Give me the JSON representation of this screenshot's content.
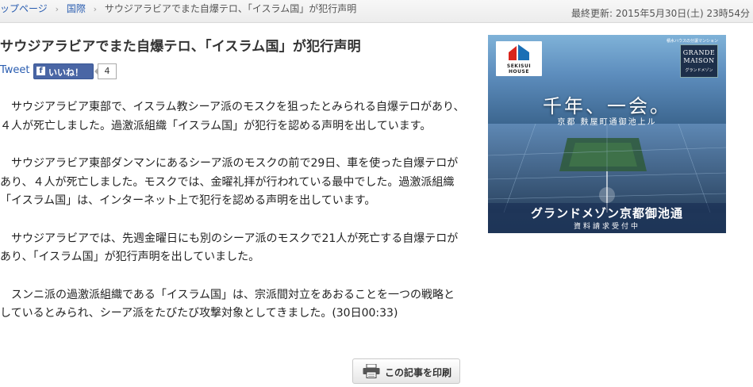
{
  "breadcrumb": {
    "items": [
      "ップページ",
      "国際",
      "サウジアラビアでまた自爆テロ、「イスラム国」が犯行声明"
    ],
    "separator": "›"
  },
  "updated": "最終更新: 2015年5月30日(土) 23時54分",
  "article": {
    "title": "サウジアラビアでまた自爆テロ、「イスラム国」が犯行声明",
    "paragraphs": [
      "サウジアラビア東部で、イスラム教シーア派のモスクを狙ったとみられる自爆テロがあり、４人が死亡しました。過激派組織「イスラム国」が犯行を認める声明を出しています。",
      "サウジアラビア東部ダンマンにあるシーア派のモスクの前で29日、車を使った自爆テロがあり、４人が死亡しました。モスクでは、金曜礼拝が行われている最中でした。過激派組織「イスラム国」は、インターネット上で犯行を認める声明を出しています。",
      "サウジアラビアでは、先週金曜日にも別のシーア派のモスクで21人が死亡する自爆テロがあり、「イスラム国」が犯行声明を出していました。",
      "スンニ派の過激派組織である「イスラム国」は、宗派間対立をあおることを一つの戦略としているとみられ、シーア派をたびたび攻撃対象としてきました。(30日00:33)"
    ]
  },
  "social": {
    "tweet_label": "Tweet",
    "like_icon": "f",
    "like_label": "いいね！",
    "like_count": "4"
  },
  "print_button": {
    "label": "この記事を印刷",
    "icon": "printer-icon"
  },
  "ad": {
    "brand": "SEKISUI HOUSE",
    "sub_label": "積水ハウスの分譲マンション",
    "grande_line1": "GRANDE",
    "grande_line2": "MAISON",
    "grande_line3": "グランドメゾン",
    "headline": "千年、一会。",
    "tagline": "京都 麩屋町通御池上ル",
    "cta": "グランドメゾン京都御池通",
    "cta_sub": "資料請求受付中"
  },
  "colors": {
    "link": "#2a5db0",
    "facebook": "#4a66a5",
    "ad_brand_red": "#d9251d",
    "ad_brand_blue": "#1a6fb5"
  }
}
